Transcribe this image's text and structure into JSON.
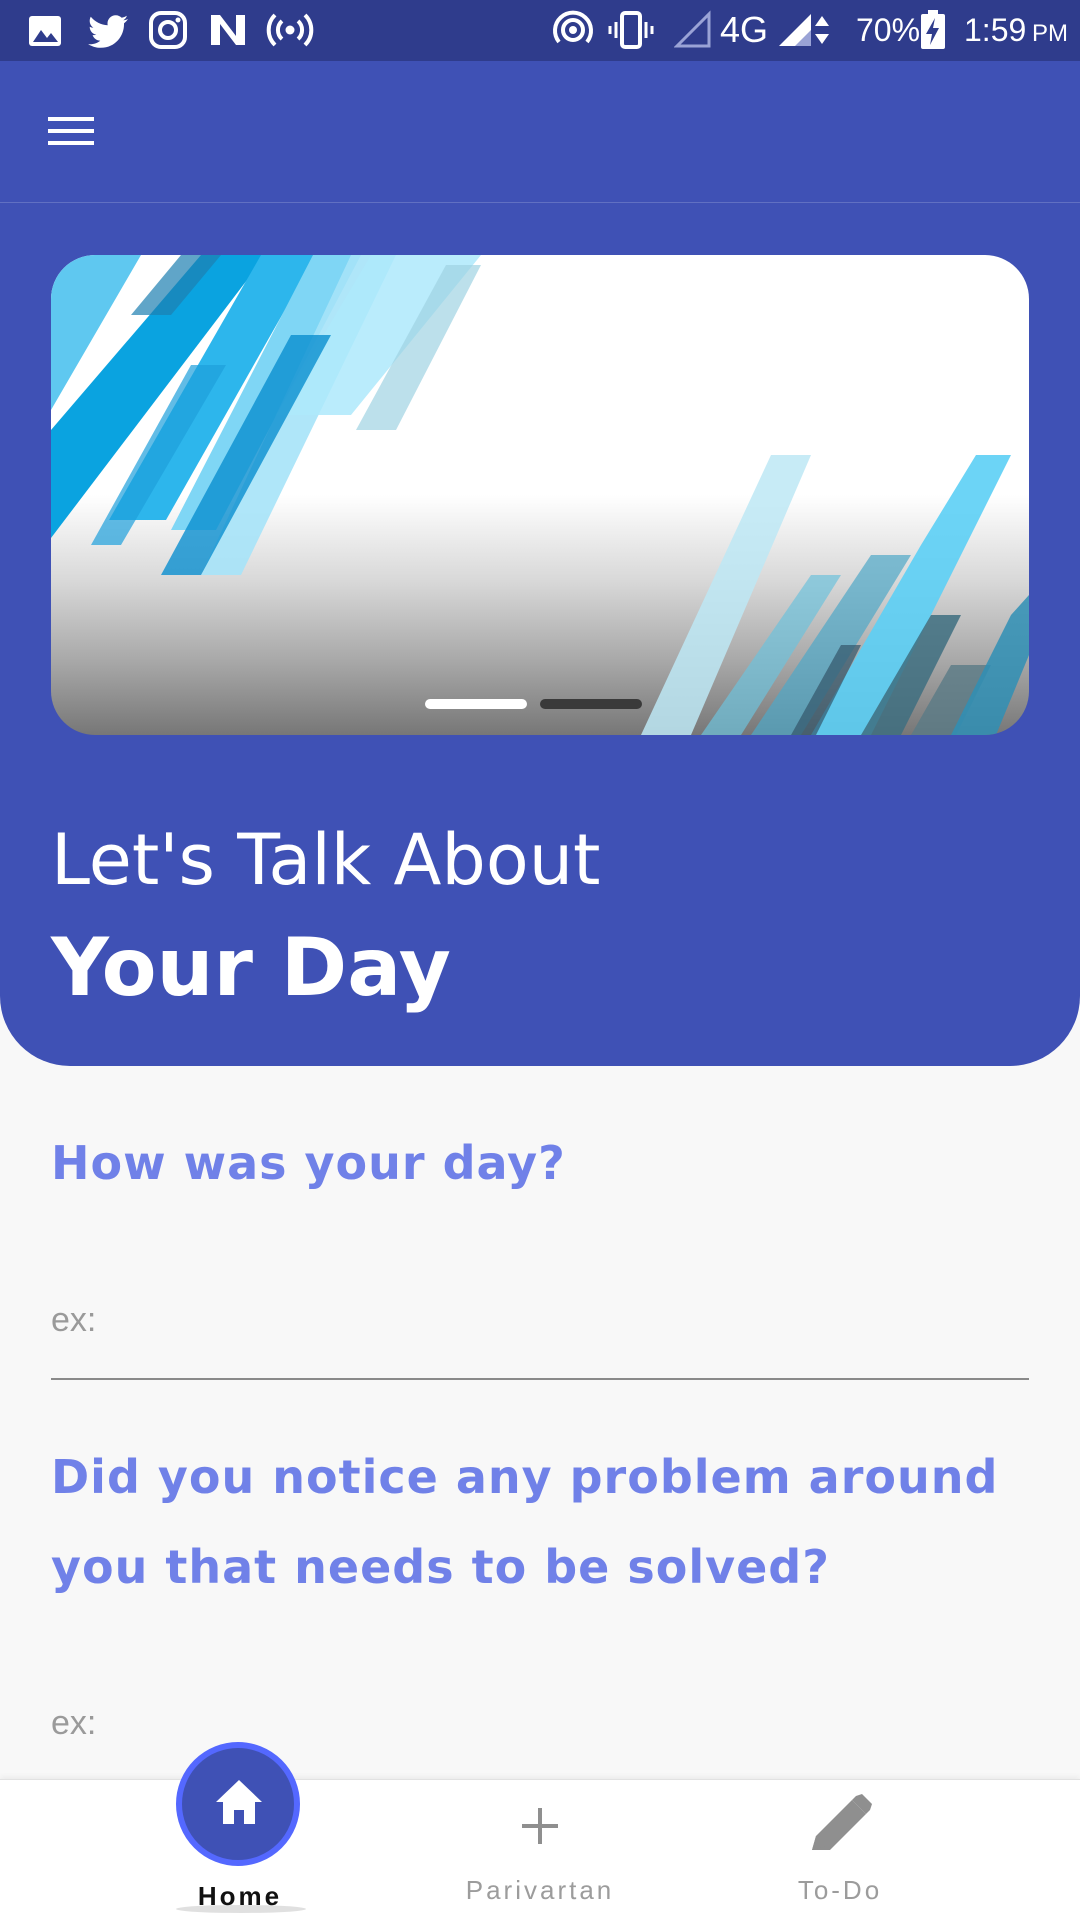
{
  "status_bar": {
    "left_icons": [
      "gallery-icon",
      "twitter-icon",
      "instagram-icon",
      "n-app-icon",
      "hotspot-broadcast-icon"
    ],
    "right_icons": [
      "wireless-icon",
      "vibrate-icon",
      "signal-empty-icon",
      "signal-4g-icon",
      "battery-charging-icon"
    ],
    "network_label": "4G",
    "battery": "70%",
    "time": "1:59",
    "ampm": "PM"
  },
  "app_bar": {
    "menu_icon": "hamburger-menu-icon"
  },
  "banner": {
    "slide_count": 2,
    "active_slide": 1
  },
  "hero": {
    "line1": "Let's Talk About",
    "line2": "Your Day"
  },
  "form": {
    "q1": {
      "label": "How was your day?",
      "placeholder": "ex:",
      "value": ""
    },
    "q2": {
      "label": "Did you notice any problem around you that needs to be solved?",
      "placeholder": "ex:",
      "value": ""
    }
  },
  "bottom_nav": {
    "items": [
      {
        "label": "Home",
        "icon": "home-icon",
        "active": true
      },
      {
        "label": "Parivartan",
        "icon": "plus-icon",
        "active": false
      },
      {
        "label": "To-Do",
        "icon": "pencil-icon",
        "active": false
      }
    ]
  },
  "colors": {
    "status_bar": "#2f3c8c",
    "primary": "#3f51b5",
    "question_text": "#7081e8",
    "home_ring": "#5468ff"
  }
}
